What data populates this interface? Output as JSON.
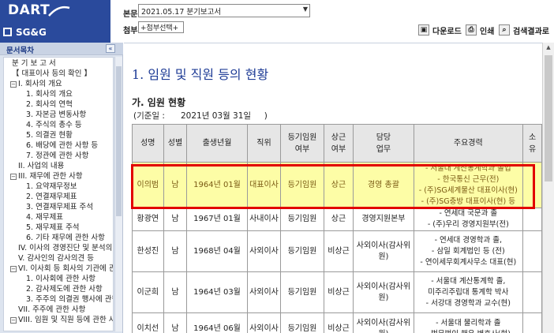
{
  "app": {
    "logo": "DART",
    "company": "SG&G"
  },
  "report": {
    "label": "본문",
    "selected": "2021.05.17 분기보고서"
  },
  "attachment": {
    "label": "첨부",
    "selected": "+첨부선택+"
  },
  "toolbar": {
    "download": "다운로드",
    "print": "인쇄",
    "search_results": "검색결과로"
  },
  "toc": {
    "title": "문서목차",
    "collapse": "«",
    "items": [
      "분 기 보 고 서",
      "【 대표이사 등의 확인 】",
      "I. 회사의 개요",
      "1. 회사의 개요",
      "2. 회사의 연혁",
      "3. 자본금 변동사항",
      "4. 주식의 총수 등",
      "5. 의결권 현황",
      "6. 배당에 관한 사항 등",
      "7. 정관에 관한 사항",
      "II. 사업의 내용",
      "III. 재무에 관한 사항",
      "1. 요약재무정보",
      "2. 연결재무제표",
      "3. 연결재무제표 주석",
      "4. 재무제표",
      "5. 재무제표 주석",
      "6. 기타 재무에 관한 사항",
      "IV. 이사의 경영진단 및 분석의견",
      "V. 감사인의 감사의견 등",
      "VI. 이사회 등 회사의 기관에 관한",
      "1. 이사회에 관한 사항",
      "2. 감사제도에 관한 사항",
      "3. 주주의 의결권 행사에 관한 ...",
      "VII. 주주에 관한 사항",
      "VIII. 임원 및 직원 등에 관한 사항"
    ]
  },
  "content": {
    "section_title": "1. 임원 및 직원 등의 현황",
    "sub_title": "가. 임원 현황",
    "base_date": "(기준일 :      2021년 03월 31일     )",
    "headers": [
      "성명",
      "성별",
      "출생년월",
      "직위",
      "등기임원\n여부",
      "상근\n여부",
      "담당\n업무",
      "주요경력",
      "소\n유"
    ],
    "rows": [
      {
        "name": "이의범",
        "gender": "남",
        "birth": "1964년 01월",
        "position": "대표이사",
        "registered": "등기임원",
        "fulltime": "상근",
        "duty": "경영 총괄",
        "career": [
          "- 서울대 계산통계학과 졸업",
          "- 한국통신 근무(전)",
          "- (주)SG세계물산 대표이사(현)",
          "- (주)SG충방 대표이사(현) 등"
        ]
      },
      {
        "name": "황광연",
        "gender": "남",
        "birth": "1967년 01월",
        "position": "사내이사",
        "registered": "등기임원",
        "fulltime": "상근",
        "duty": "경영지원본부",
        "career": [
          "- 연세대 국문과 졸",
          "- (주)우리 경영지원부(전)"
        ]
      },
      {
        "name": "한성진",
        "gender": "남",
        "birth": "1968년 04월",
        "position": "사외이사",
        "registered": "등기임원",
        "fulltime": "비상근",
        "duty": "사외이사(감사위원)",
        "career": [
          "- 연세대 경영학과 졸,",
          "- 삼일 회계법인 등 (전)",
          "- 연이세무회계사무소 대표(현)"
        ]
      },
      {
        "name": "이군희",
        "gender": "남",
        "birth": "1964년 03월",
        "position": "사외이사",
        "registered": "등기임원",
        "fulltime": "비상근",
        "duty": "사외이사(감사위원)",
        "career": [
          "- 서울대 계산통계학 졸,",
          "미주리주립대 통계학 박사",
          "- 서강대 경영학과 교수(현)"
        ]
      },
      {
        "name": "이치선",
        "gender": "남",
        "birth": "1964년 06월",
        "position": "사외이사",
        "registered": "등기임원",
        "fulltime": "비상근",
        "duty": "사외이사(감사위원)",
        "career": [
          "- 서울대 물리학과 졸",
          "- 법무법인 해우 변호사(현)"
        ]
      }
    ]
  }
}
